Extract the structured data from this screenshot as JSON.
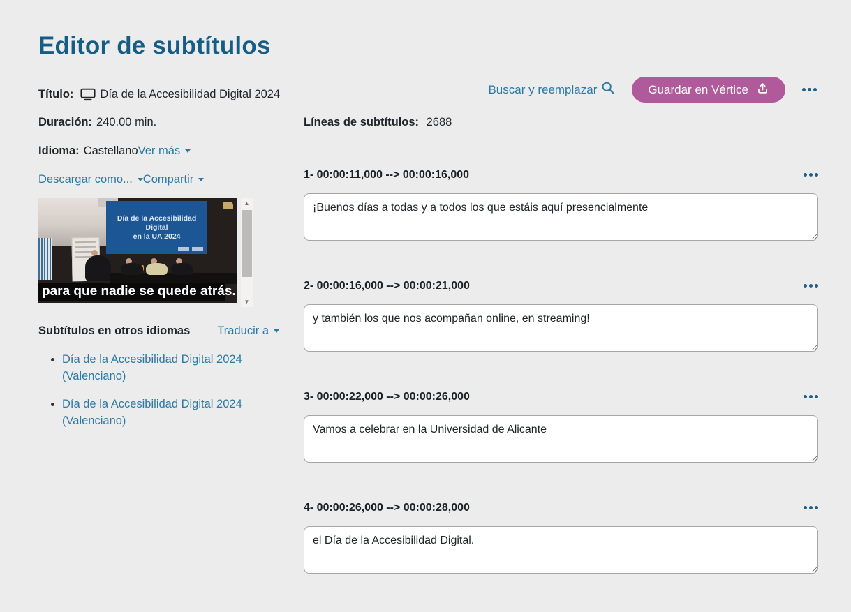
{
  "app": {
    "heading": "Editor de subtítulos"
  },
  "colors": {
    "page_bg": "#ececec",
    "heading_blue": "#155d85",
    "link_teal": "#2b7aa5",
    "button_pink": "#b0599b",
    "slide_blue": "#1d5694"
  },
  "header": {
    "title_label": "Título:",
    "title_value": "Día de la Accesibilidad Digital 2024",
    "search_label": "Buscar y reemplazar",
    "save_button_label": "Guardar en Vértice"
  },
  "icons": {
    "title": "monitor-icon",
    "search": "search-icon",
    "save": "upload-icon",
    "more": "ellipsis-icon",
    "dropdowns": "caret-down-icon",
    "scrollbar": "scroll-up-icon / scroll-down-icon"
  },
  "details": {
    "duration_label": "Duración:",
    "duration_value": "240.00 min.",
    "language_label": "Idioma:",
    "language_value": "Castellano",
    "see_more_label": "Ver más",
    "download_label": "Descargar como...",
    "share_label": "Compartir"
  },
  "video_preview": {
    "slide_line1": "Día de la Accesibilidad Digital",
    "slide_line2": "en la UA 2024",
    "caption": "para que nadie se quede atrás."
  },
  "other_languages": {
    "heading": "Subtítulos en otros idiomas",
    "translate_label": "Traducir a",
    "links": [
      "Día de la Accesibilidad Digital 2024 (Valenciano)",
      "Día de la Accesibilidad Digital 2024 (Valenciano)"
    ]
  },
  "subtitles": {
    "count_label": "Líneas de subtítulos:",
    "count_value": "2688",
    "entries": [
      {
        "header": "1- 00:00:11,000 --> 00:00:16,000",
        "text": "¡Buenos días a todas y a todos los que estáis aquí presencialmente"
      },
      {
        "header": "2- 00:00:16,000 --> 00:00:21,000",
        "text": "y también los que nos acompañan online, en streaming!"
      },
      {
        "header": "3- 00:00:22,000 --> 00:00:26,000",
        "text": "Vamos a celebrar en la Universidad de Alicante"
      },
      {
        "header": "4- 00:00:26,000 --> 00:00:28,000",
        "text": "el Día de la Accesibilidad Digital."
      }
    ]
  }
}
